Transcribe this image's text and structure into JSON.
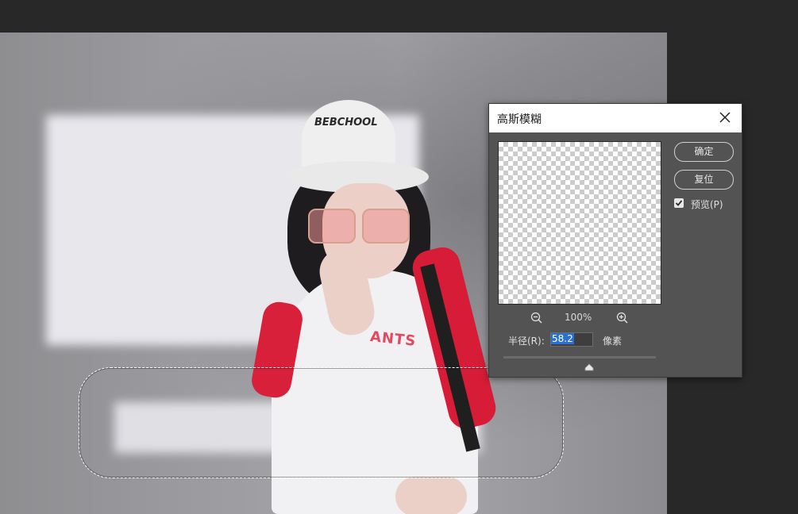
{
  "dialog": {
    "title": "高斯模糊",
    "ok_label": "确定",
    "reset_label": "复位",
    "preview_label": "预览(P)",
    "preview_checked": true,
    "zoom_level": "100%",
    "radius_label": "半径(R):",
    "radius_value": "58.2",
    "unit_label": "像素",
    "slider_fraction": 0.56
  },
  "canvas": {
    "hat_text": "BEBCHOOL",
    "shirt_text": "ANTS"
  },
  "icons": {
    "close": "close-icon",
    "zoom_out": "zoom-out-icon",
    "zoom_in": "zoom-in-icon",
    "check": "checkmark-icon",
    "slider_thumb": "slider-thumb-icon"
  },
  "colors": {
    "dialog_bg": "#535353",
    "titlebar_bg": "#ffffff",
    "selection_highlight": "#2a6fd6"
  }
}
